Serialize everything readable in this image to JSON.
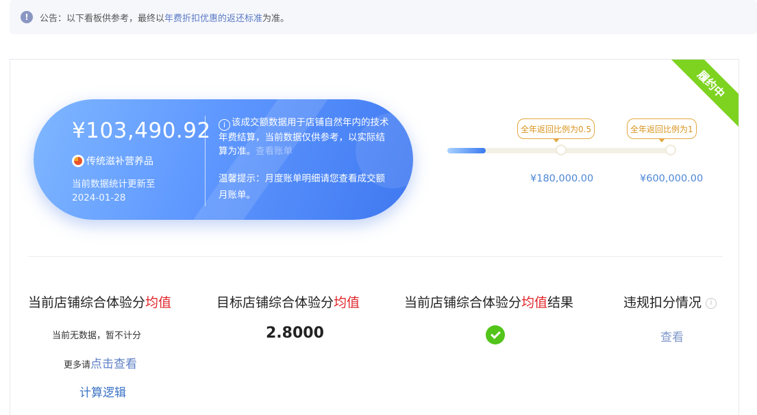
{
  "notice": {
    "prefix": "公告：以下看板供参考，最终以",
    "link": "年费折扣优惠的返还标准",
    "suffix": "为准。"
  },
  "status_ribbon": "履约中",
  "summary": {
    "amount": "¥103,490.92",
    "shop_name": "传统滋补营养品",
    "update_label": "当前数据统计更新至",
    "update_date": "2024-01-28",
    "description": "该成交额数据用于店铺自然年内的技术年费结算，当前数据仅供参考，以实际结算为准。",
    "view_bill": "查看账单",
    "tip": "温馨提示：月度账单明细请您查看成交额月账单。"
  },
  "tiers": [
    {
      "label": "全年返回比例为0.5",
      "amount": "¥180,000.00"
    },
    {
      "label": "全年返回比例为1",
      "amount": "¥600,000.00"
    }
  ],
  "progress_fraction": 0.17,
  "metrics": {
    "current_avg": {
      "title_prefix": "当前店铺综合体验分",
      "title_highlight": "均值",
      "no_data": "当前无数据，暂不计分",
      "more_prefix": "更多请",
      "more_link": "点击查看",
      "logic_link": "计算逻辑"
    },
    "target_avg": {
      "title_prefix": "目标店铺综合体验分",
      "title_highlight": "均值",
      "value": "2.8000"
    },
    "result": {
      "title_prefix": "当前店铺综合体验分",
      "title_highlight": "均值",
      "title_suffix": "结果"
    },
    "violation": {
      "title": "违规扣分情况",
      "view_link": "查看"
    }
  },
  "colors": {
    "accent_blue": "#3f78f0",
    "ribbon_green": "#7ed321",
    "highlight_red": "#e0262a",
    "badge_orange": "#e4a741",
    "success_green": "#52c41a"
  }
}
